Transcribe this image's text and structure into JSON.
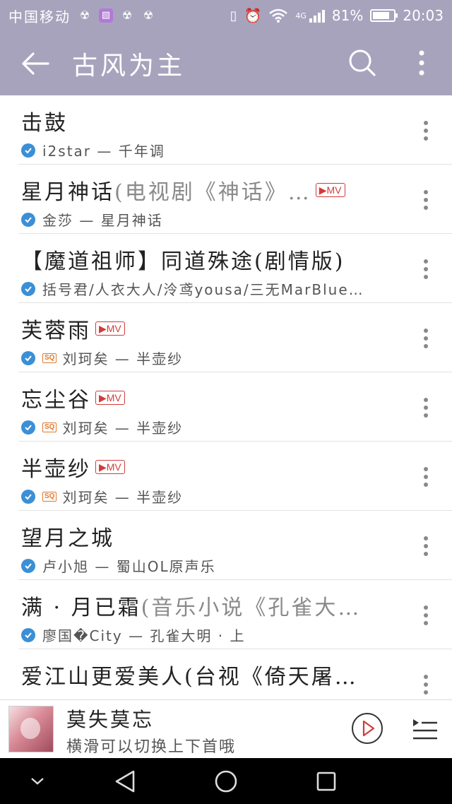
{
  "status_bar": {
    "carrier": "中国移动",
    "network": "4G",
    "battery_percent_text": "81%",
    "battery_level": 0.81,
    "time": "20:03"
  },
  "app_bar": {
    "title": "古风为主",
    "back_icon": "arrow-left-icon",
    "search_icon": "search-icon",
    "more_icon": "more-vertical-icon",
    "color": "#a8a3bd"
  },
  "songs": [
    {
      "title": "击鼓",
      "subtitle": "",
      "mv": false,
      "sq": false,
      "meta": "i2star — 千年调"
    },
    {
      "title": "星月神话",
      "subtitle": "(电视剧《神话》…",
      "mv": true,
      "sq": false,
      "meta": "金莎 — 星月神话"
    },
    {
      "title": "【魔道祖师】同道殊途(剧情版)",
      "subtitle": "",
      "mv": false,
      "sq": false,
      "meta": "括号君/人衣大人/泠鸢yousa/三无MarBlue…"
    },
    {
      "title": "芙蓉雨",
      "subtitle": "",
      "mv": true,
      "sq": true,
      "meta": "刘珂矣 — 半壶纱"
    },
    {
      "title": "忘尘谷",
      "subtitle": "",
      "mv": true,
      "sq": true,
      "meta": "刘珂矣 — 半壶纱"
    },
    {
      "title": "半壶纱",
      "subtitle": "",
      "mv": true,
      "sq": true,
      "meta": "刘珂矣 — 半壶纱"
    },
    {
      "title": "望月之城",
      "subtitle": "",
      "mv": false,
      "sq": false,
      "meta": "卢小旭 — 蜀山OL原声乐"
    },
    {
      "title": "满 · 月已霜",
      "subtitle": "(音乐小说《孔雀大…",
      "mv": false,
      "sq": false,
      "meta": "廖国�City — 孔雀大明 · 上"
    },
    {
      "title": "爱江山更爱美人(台视《倚天屠…",
      "subtitle": "",
      "mv": false,
      "sq": false,
      "meta": ""
    }
  ],
  "badges": {
    "mv_label": "▶MV",
    "sq_label": "SQ",
    "mv_color": "#d23b3b",
    "sq_color": "#e0792e",
    "check_color": "#3b8fd6"
  },
  "mini_player": {
    "title": "莫失莫忘",
    "subtitle": "横滑可以切换上下首哦",
    "play_icon": "play-circle-icon",
    "queue_icon": "playlist-icon"
  },
  "nav_bar": {
    "collapse_icon": "chevron-down-icon",
    "back_icon": "triangle-back-icon",
    "home_icon": "circle-home-icon",
    "recents_icon": "square-recents-icon"
  }
}
